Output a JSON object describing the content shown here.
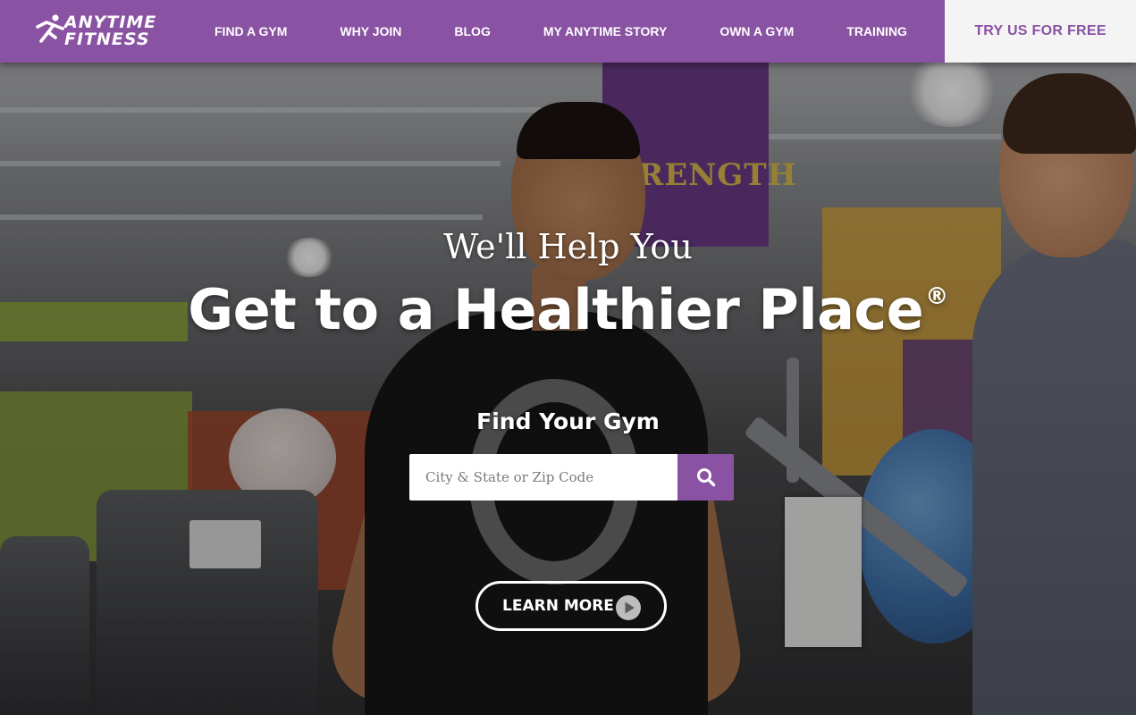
{
  "brand": {
    "logo_line1": "ANYTIME",
    "logo_line2": "FITNESS",
    "icon": "running-man-logo-icon",
    "primary_color": "#8a52a3",
    "cta_bg_color": "#f4f4f4"
  },
  "nav": {
    "items": [
      {
        "label": "FIND A GYM"
      },
      {
        "label": "WHY JOIN"
      },
      {
        "label": "BLOG"
      },
      {
        "label": "MY ANYTIME STORY"
      },
      {
        "label": "OWN A GYM"
      },
      {
        "label": "TRAINING"
      }
    ],
    "cta_label": "TRY US FOR FREE"
  },
  "hero": {
    "subheadline": "We'll Help You",
    "headline": "Get to a Healthier Place",
    "headline_mark": "®",
    "background_banner_text": "RENGTH",
    "find_title": "Find Your Gym",
    "search": {
      "placeholder": "City & State or Zip Code",
      "value": "",
      "button_icon": "search-icon"
    },
    "learn_more_label": "LEARN MORE",
    "learn_more_icon": "play-icon"
  }
}
